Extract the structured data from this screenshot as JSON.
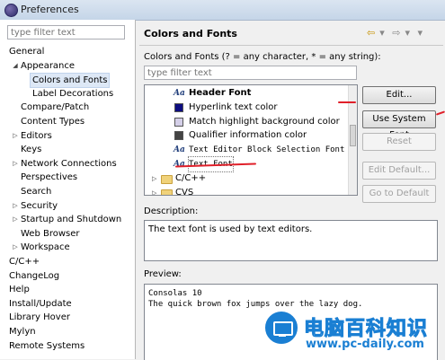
{
  "window": {
    "title": "Preferences"
  },
  "left": {
    "filter_placeholder": "type filter text",
    "tree": [
      {
        "label": "General",
        "indent": 0,
        "arrow": ""
      },
      {
        "label": "Appearance",
        "indent": 1,
        "arrow": "expanded"
      },
      {
        "label": "Colors and Fonts",
        "indent": 2,
        "arrow": "",
        "selected": true
      },
      {
        "label": "Label Decorations",
        "indent": 2,
        "arrow": ""
      },
      {
        "label": "Compare/Patch",
        "indent": 1,
        "arrow": ""
      },
      {
        "label": "Content Types",
        "indent": 1,
        "arrow": ""
      },
      {
        "label": "Editors",
        "indent": 1,
        "arrow": "collapsed"
      },
      {
        "label": "Keys",
        "indent": 1,
        "arrow": ""
      },
      {
        "label": "Network Connections",
        "indent": 1,
        "arrow": "collapsed"
      },
      {
        "label": "Perspectives",
        "indent": 1,
        "arrow": ""
      },
      {
        "label": "Search",
        "indent": 1,
        "arrow": ""
      },
      {
        "label": "Security",
        "indent": 1,
        "arrow": "collapsed"
      },
      {
        "label": "Startup and Shutdown",
        "indent": 1,
        "arrow": "collapsed"
      },
      {
        "label": "Web Browser",
        "indent": 1,
        "arrow": ""
      },
      {
        "label": "Workspace",
        "indent": 1,
        "arrow": "collapsed"
      },
      {
        "label": "C/C++",
        "indent": 0,
        "arrow": ""
      },
      {
        "label": "ChangeLog",
        "indent": 0,
        "arrow": ""
      },
      {
        "label": "Help",
        "indent": 0,
        "arrow": ""
      },
      {
        "label": "Install/Update",
        "indent": 0,
        "arrow": ""
      },
      {
        "label": "Library Hover",
        "indent": 0,
        "arrow": ""
      },
      {
        "label": "Mylyn",
        "indent": 0,
        "arrow": ""
      },
      {
        "label": "Remote Systems",
        "indent": 0,
        "arrow": ""
      }
    ]
  },
  "main": {
    "heading": "Colors and Fonts",
    "description": "Colors and Fonts (? = any character, * = any string):",
    "filter_placeholder": "type filter text",
    "list": [
      {
        "label": "Header Font",
        "icon": "font-icon",
        "bold": true
      },
      {
        "label": "Hyperlink text color",
        "icon": "color-swatch",
        "color": "#0d0d80"
      },
      {
        "label": "Match highlight background color",
        "icon": "color-swatch",
        "color": "#d4cfe8"
      },
      {
        "label": "Qualifier information color",
        "icon": "color-swatch",
        "color": "#444444"
      },
      {
        "label": "Text Editor Block Selection Font",
        "icon": "font-icon",
        "mono": true
      },
      {
        "label": "Text Font",
        "icon": "font-icon",
        "mono": true,
        "selected": true
      },
      {
        "label": "C/C++",
        "icon": "folder-icon",
        "category": true
      },
      {
        "label": "CVS",
        "icon": "folder-icon",
        "category": true
      }
    ],
    "buttons": {
      "edit": "Edit...",
      "use_system_font": "Use System Font",
      "reset": "Reset",
      "edit_default": "Edit Default...",
      "go_to_default": "Go to Default"
    },
    "description_label": "Description:",
    "description_text": "The text font is used by text editors.",
    "preview_label": "Preview:",
    "preview_lines": [
      "Consolas 10",
      "The quick brown fox jumps over the lazy dog."
    ]
  },
  "watermark": {
    "title": "电脑百科知识",
    "url": "www.pc-daily.com"
  },
  "colors": {
    "annotation_red": "#e0202a",
    "selection": "#dde8f6",
    "watermark_blue": "#1a7fd3"
  }
}
